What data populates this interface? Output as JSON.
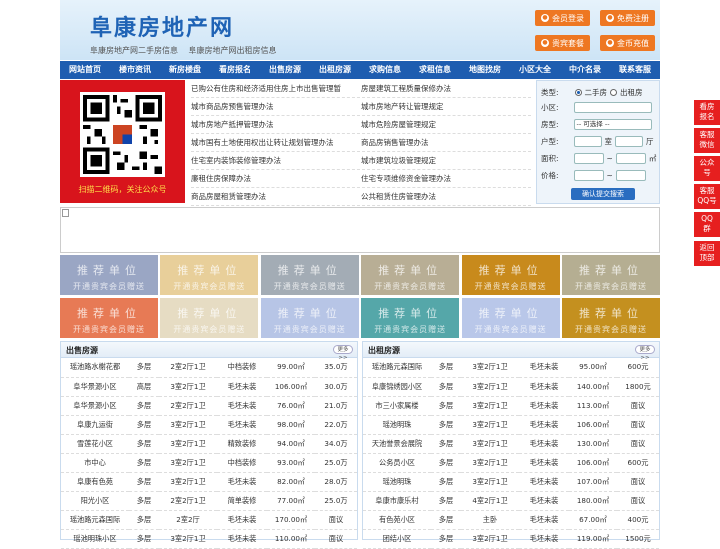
{
  "site": {
    "title": "阜康房地产网",
    "sublinks": [
      "阜康房地产网二手房信息",
      "阜康房地产网出租房信息"
    ]
  },
  "header_buttons": [
    "会员登录",
    "免费注册",
    "贵宾套餐",
    "金币充值"
  ],
  "nav": [
    "网站首页",
    "楼市资讯",
    "新房楼盘",
    "看房报名",
    "出售房源",
    "出租房源",
    "求购信息",
    "求租信息",
    "地图找房",
    "小区大全",
    "中介名录",
    "联系客服"
  ],
  "qr": {
    "caption": "扫描二维码，关注公众号"
  },
  "links": [
    [
      "已购公有住房和经济适用住房上市出售管理暂",
      "房屋建筑工程质量保修办法"
    ],
    [
      "城市商品房预售管理办法",
      "城市房地产转让管理规定"
    ],
    [
      "城市房地产抵押管理办法",
      "城市危险房屋管理规定"
    ],
    [
      "城市国有土地使用权出让转让规划管理办法",
      "商品房销售管理办法"
    ],
    [
      "住宅室内装饰装修管理办法",
      "城市建筑垃圾管理规定"
    ],
    [
      "廉租住房保障办法",
      "住宅专项维修资金管理办法"
    ],
    [
      "商品房屋租赁管理办法",
      "公共租赁住房管理办法"
    ]
  ],
  "search": {
    "type_label": "类型:",
    "opt_sale": "二手房",
    "opt_rent": "出租房",
    "xiaoqu_label": "小区:",
    "fangxing_label": "房型:",
    "fangxing_value": "-- 可选择 --",
    "huxing_label": "户型:",
    "shi": "室",
    "ting": "厅",
    "area_label": "面积:",
    "area_unit": "㎡",
    "price_label": "价格:",
    "tilde": "~",
    "submit": "确认提交搜索"
  },
  "tiles": {
    "line1": "推荐单位",
    "line2": "开通贵宾会员赠送",
    "colors": [
      "#9aa6c4",
      "#e8cf9a",
      "#a3acb5",
      "#b8ae95",
      "#c88a1c",
      "#b5ae92",
      "#e77a55",
      "#e6dcc3",
      "#b7c5e6",
      "#55a7a9",
      "#b9c7e9",
      "#c4901f"
    ]
  },
  "sale": {
    "title": "出售房源",
    "more": "更多>>",
    "rows": [
      [
        "瑶池路水榭花都",
        "多层",
        "2室2厅1卫",
        "中档装修",
        "99.00㎡",
        "35.0万"
      ],
      [
        "阜华景源小区",
        "高层",
        "3室2厅1卫",
        "毛坯未装",
        "106.00㎡",
        "30.0万"
      ],
      [
        "阜华景源小区",
        "多层",
        "2室2厅1卫",
        "毛坯未装",
        "76.00㎡",
        "21.0万"
      ],
      [
        "阜康九运街",
        "多层",
        "3室2厅1卫",
        "毛坯未装",
        "98.00㎡",
        "22.0万"
      ],
      [
        "雪莲花小区",
        "多层",
        "3室2厅1卫",
        "精致装修",
        "94.00㎡",
        "34.0万"
      ],
      [
        "市中心",
        "多层",
        "3室2厅1卫",
        "中档装修",
        "93.00㎡",
        "25.0万"
      ],
      [
        "阜康有色苑",
        "多层",
        "3室2厅1卫",
        "毛坯未装",
        "82.00㎡",
        "28.0万"
      ],
      [
        "阳光小区",
        "多层",
        "2室2厅1卫",
        "简单装修",
        "77.00㎡",
        "25.0万"
      ],
      [
        "瑶池路元森国际",
        "多层",
        "2室2厅",
        "毛坯未装",
        "170.00㎡",
        "面议"
      ],
      [
        "瑶池明珠小区",
        "多层",
        "3室2厅1卫",
        "毛坯未装",
        "110.00㎡",
        "面议"
      ]
    ]
  },
  "rent": {
    "title": "出租房源",
    "more": "更多>>",
    "rows": [
      [
        "瑶池路元森国际",
        "多层",
        "3室2厅1卫",
        "毛坯未装",
        "95.00㎡",
        "600元"
      ],
      [
        "阜康锦绣园小区",
        "多层",
        "3室2厅1卫",
        "毛坯未装",
        "140.00㎡",
        "1800元"
      ],
      [
        "市三小家属楼",
        "多层",
        "3室2厅1卫",
        "毛坯未装",
        "113.00㎡",
        "面议"
      ],
      [
        "瑶池明珠",
        "多层",
        "3室2厅1卫",
        "毛坯未装",
        "106.00㎡",
        "面议"
      ],
      [
        "天池誉景会展院",
        "多层",
        "3室2厅1卫",
        "毛坯未装",
        "130.00㎡",
        "面议"
      ],
      [
        "公务员小区",
        "多层",
        "3室2厅1卫",
        "毛坯未装",
        "106.00㎡",
        "600元"
      ],
      [
        "瑶池明珠",
        "多层",
        "3室2厅1卫",
        "毛坯未装",
        "107.00㎡",
        "面议"
      ],
      [
        "阜康市康乐村",
        "多层",
        "4室2厅1卫",
        "毛坯未装",
        "180.00㎡",
        "面议"
      ],
      [
        "有色苑小区",
        "多层",
        "主卧",
        "毛坯未装",
        "67.00㎡",
        "400元"
      ],
      [
        "团结小区",
        "多层",
        "3室2厅1卫",
        "毛坯未装",
        "119.00㎡",
        "1500元"
      ]
    ]
  },
  "side": [
    "看房\n报名",
    "客服\n微信",
    "公众\n号",
    "客服\nQQ号",
    "QQ\n群",
    "返回\n顶部"
  ],
  "colors": {
    "nav": "#1e5db0",
    "accent": "#ee7722",
    "side": "#e61f1f"
  }
}
